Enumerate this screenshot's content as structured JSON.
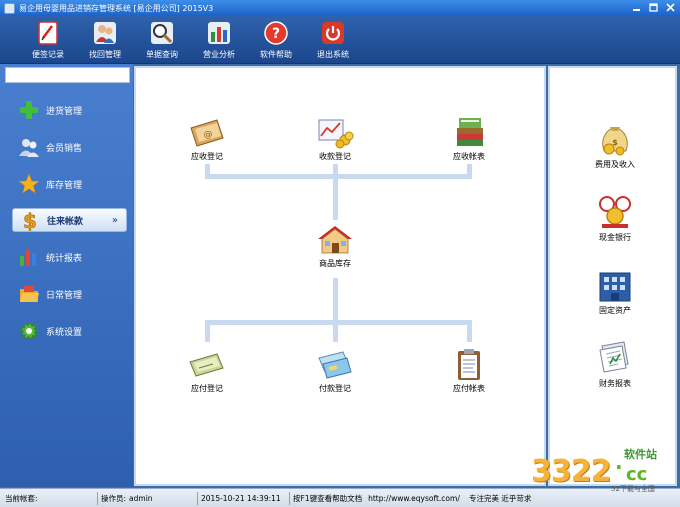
{
  "window": {
    "title": "易企用母婴用品进销存管理系统 [易企用公司] 2015V3",
    "controls": [
      "minimize-icon",
      "maximize-icon",
      "close-icon"
    ]
  },
  "toolbar": {
    "buttons": [
      {
        "label": "便签记录",
        "icon": "notepad-icon"
      },
      {
        "label": "找回管理",
        "icon": "users-icon"
      },
      {
        "label": "单据查询",
        "icon": "magnifier-icon"
      },
      {
        "label": "营业分析",
        "icon": "bar-chart-icon"
      },
      {
        "label": "软件帮助",
        "icon": "help-icon"
      },
      {
        "label": "退出系统",
        "icon": "power-icon"
      }
    ]
  },
  "sidebar": {
    "items": [
      {
        "label": "进货管理",
        "icon": "plus-icon",
        "active": false
      },
      {
        "label": "会员销售",
        "icon": "members-icon",
        "active": false
      },
      {
        "label": "库存管理",
        "icon": "star-icon",
        "active": false
      },
      {
        "label": "往来帐款",
        "icon": "dollar-icon",
        "active": true,
        "chevron": "»"
      },
      {
        "label": "统计报表",
        "icon": "chart-icon",
        "active": false
      },
      {
        "label": "日常管理",
        "icon": "folder-icon",
        "active": false
      },
      {
        "label": "系统设置",
        "icon": "gear-icon",
        "active": false
      }
    ]
  },
  "main": {
    "top_row": [
      {
        "label": "应收登记",
        "icon": "receivable-book-icon"
      },
      {
        "label": "收款登记",
        "icon": "cash-receipt-icon"
      },
      {
        "label": "应收帐表",
        "icon": "books-stack-icon"
      }
    ],
    "center": {
      "label": "商品库存",
      "icon": "house-icon"
    },
    "bottom_row": [
      {
        "label": "应付登记",
        "icon": "payable-check-icon"
      },
      {
        "label": "付款登记",
        "icon": "payment-cards-icon"
      },
      {
        "label": "应付帐表",
        "icon": "clipboard-icon"
      }
    ]
  },
  "right": {
    "items": [
      {
        "label": "费用及收入",
        "icon": "money-bag-icon"
      },
      {
        "label": "现金银行",
        "icon": "coins-bank-icon"
      },
      {
        "label": "固定资产",
        "icon": "building-icon"
      },
      {
        "label": "财务报表",
        "icon": "report-pages-icon"
      }
    ]
  },
  "status": {
    "account_label": "当前帐套:",
    "account_value": "",
    "operator_label": "操作员:",
    "operator_value": "admin",
    "datetime": "2015-10-21 14:39:11",
    "tip": "按F1键查看帮助文档",
    "url": "http://www.eqysoft.com/",
    "slogan": "专注完美  近乎苛求"
  },
  "watermark": {
    "number": "3322",
    "dot": ".",
    "tld": "cc",
    "site_label": "软件站",
    "sub": "52下载与全国"
  }
}
